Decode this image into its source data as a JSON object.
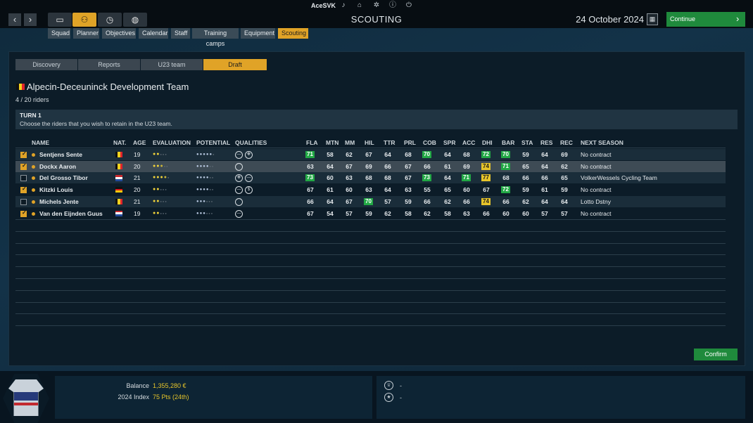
{
  "topbar": {
    "username": "AceSVK",
    "page_title": "SCOUTING",
    "date": "24 October 2024",
    "continue_label": "Continue"
  },
  "subtabs": [
    "Squad",
    "Planner",
    "Objectives",
    "Calendar",
    "Staff",
    "Training camps",
    "Equipment",
    "Scouting"
  ],
  "draft_tabs": [
    "Discovery",
    "Reports",
    "U23 team",
    "Draft"
  ],
  "team": {
    "name": "Alpecin-Deceuninck Development Team",
    "count": "4 / 20 riders"
  },
  "turn": {
    "title": "TURN 1",
    "instruction": "Choose the riders that you wish to retain in the U23 team."
  },
  "columns": {
    "name": "NAME",
    "nat": "NAT.",
    "age": "AGE",
    "evaluation": "EVALUATION",
    "potential": "POTENTIAL",
    "qualities": "QUALITIES",
    "fla": "FLA",
    "mtn": "MTN",
    "mm": "MM",
    "hil": "HIL",
    "ttr": "TTR",
    "prl": "PRL",
    "cob": "COB",
    "spr": "SPR",
    "acc": "ACC",
    "dhi": "DHI",
    "bar": "BAR",
    "sta": "STA",
    "res": "RES",
    "rec": "REC",
    "next": "NEXT SEASON"
  },
  "riders": [
    {
      "checked": true,
      "name": "Sentjens Sente",
      "nat": "BEL",
      "age": "19",
      "eval": 2,
      "pot": 5,
      "qualities": [
        "flat-icon",
        "cobble-icon"
      ],
      "stats": [
        "71",
        "58",
        "62",
        "67",
        "64",
        "68",
        "70",
        "64",
        "68",
        "72",
        "70",
        "59",
        "64",
        "69"
      ],
      "hl": [
        "g",
        "",
        "",
        "",
        "",
        "",
        "g",
        "",
        "",
        "g",
        "g",
        "",
        "",
        ""
      ],
      "next": "No contract"
    },
    {
      "checked": true,
      "name": "Dockx Aaron",
      "nat": "BEL",
      "age": "20",
      "eval": 2.5,
      "pot": 4,
      "qualities": [
        "hill-icon"
      ],
      "stats": [
        "63",
        "64",
        "67",
        "69",
        "66",
        "67",
        "66",
        "61",
        "69",
        "74",
        "71",
        "65",
        "64",
        "62"
      ],
      "hl": [
        "",
        "",
        "",
        "",
        "",
        "",
        "",
        "",
        "",
        "y",
        "g",
        "",
        "",
        ""
      ],
      "next": "No contract"
    },
    {
      "checked": false,
      "name": "Del Grosso Tibor",
      "nat": "NED",
      "age": "21",
      "eval": 3.5,
      "pot": 4,
      "qualities": [
        "cobble-icon",
        "flat-icon"
      ],
      "stats": [
        "73",
        "60",
        "63",
        "68",
        "68",
        "67",
        "73",
        "64",
        "71",
        "77",
        "68",
        "66",
        "66",
        "65"
      ],
      "hl": [
        "g",
        "",
        "",
        "",
        "",
        "",
        "g",
        "",
        "g",
        "y",
        "",
        "",
        "",
        ""
      ],
      "next": "VolkerWessels Cycling Team"
    },
    {
      "checked": true,
      "name": "Kitzki Louis",
      "nat": "GER",
      "age": "20",
      "eval": 2,
      "pot": 4,
      "qualities": [
        "flat-icon",
        "sprint-icon"
      ],
      "stats": [
        "67",
        "61",
        "60",
        "63",
        "64",
        "63",
        "55",
        "65",
        "60",
        "67",
        "72",
        "59",
        "61",
        "59"
      ],
      "hl": [
        "",
        "",
        "",
        "",
        "",
        "",
        "",
        "",
        "",
        "",
        "g",
        "",
        "",
        ""
      ],
      "next": "No contract"
    },
    {
      "checked": false,
      "name": "Michels Jente",
      "nat": "BEL",
      "age": "21",
      "eval": 2,
      "pot": 3,
      "qualities": [
        "hill-icon"
      ],
      "stats": [
        "66",
        "64",
        "67",
        "70",
        "57",
        "59",
        "66",
        "62",
        "66",
        "74",
        "66",
        "62",
        "64",
        "64"
      ],
      "hl": [
        "",
        "",
        "",
        "g",
        "",
        "",
        "",
        "",
        "",
        "y",
        "",
        "",
        "",
        ""
      ],
      "next": "Lotto Dstny"
    },
    {
      "checked": true,
      "name": "Van den Eijnden Guus",
      "nat": "NED",
      "age": "19",
      "eval": 2,
      "pot": 3,
      "qualities": [
        "flat-icon"
      ],
      "stats": [
        "67",
        "54",
        "57",
        "59",
        "62",
        "58",
        "62",
        "58",
        "63",
        "66",
        "60",
        "60",
        "57",
        "57"
      ],
      "hl": [
        "",
        "",
        "",
        "",
        "",
        "",
        "",
        "",
        "",
        "",
        "",
        "",
        "",
        ""
      ],
      "next": "No contract"
    }
  ],
  "confirm_label": "Confirm",
  "finance": {
    "balance_label": "Balance",
    "balance_value": "1,355,280 €",
    "index_label": "2024 Index",
    "index_value": "75 Pts (24th)"
  },
  "right_panel": {
    "line1": "-",
    "line2": "-"
  },
  "colors": {
    "accent": "#e0a327",
    "green": "#22a845",
    "yellow": "#e6c42a",
    "continue": "#1f8a3c"
  }
}
